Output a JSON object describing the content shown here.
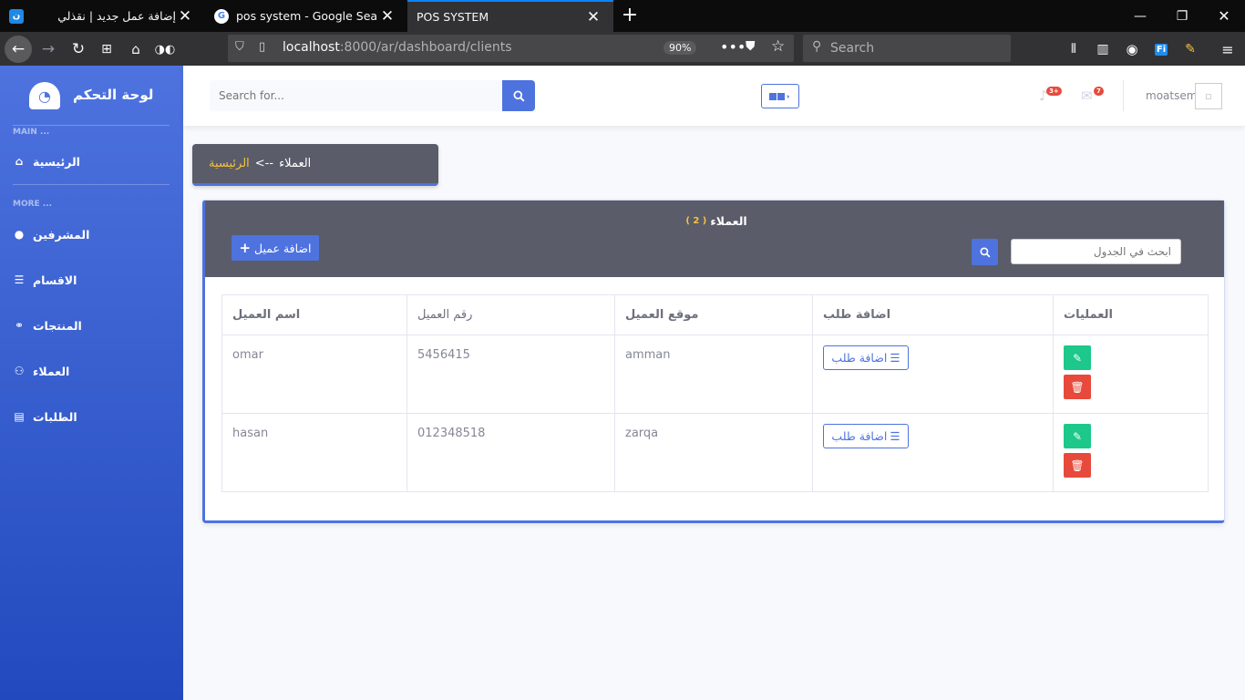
{
  "browser": {
    "tabs": [
      {
        "title": "إضافة عمل جديد | نقذلي",
        "favicon": "ن"
      },
      {
        "title": "pos system - Google Search",
        "favicon": "G"
      },
      {
        "title": "POS SYSTEM",
        "favicon": ""
      }
    ],
    "new_tab": "+",
    "url_host": "localhost",
    "url_rest": ":8000/ar/dashboard/clients",
    "zoom": "90%",
    "search_placeholder": "Search"
  },
  "sidebar": {
    "brand": "لوحة التحكم",
    "section_main": "MAIN ...",
    "section_more": "MORE ...",
    "items": [
      {
        "label": "الرئيسية",
        "icon": "home-icon"
      },
      {
        "label": "المشرفين",
        "icon": "user-circle-icon"
      },
      {
        "label": "الاقسام",
        "icon": "list-icon"
      },
      {
        "label": "المنتجات",
        "icon": "handshake-icon"
      },
      {
        "label": "العملاء",
        "icon": "users-icon"
      },
      {
        "label": "الطلبات",
        "icon": "table-icon"
      }
    ]
  },
  "topbar": {
    "search_placeholder": "Search for...",
    "alerts_badge": "3+",
    "messages_badge": "7",
    "username": "moatsem"
  },
  "breadcrumb": {
    "current": "العملاء",
    "separator": "<--",
    "home": "الرئيسية"
  },
  "card": {
    "title": "العملاء",
    "count": "( 2 )",
    "add_button": "اضافة عميل",
    "search_placeholder": "ابحث في الجدول"
  },
  "table": {
    "headers": [
      "اسم العميل",
      "رقم العميل",
      "موقع العميل",
      "اضافة طلب",
      "العمليات"
    ],
    "rows": [
      {
        "name": "omar",
        "number": "5456415",
        "location": "amman",
        "order": "اضافة طلب"
      },
      {
        "name": "hasan",
        "number": "012348518",
        "location": "zarqa",
        "order": "اضافة طلب"
      }
    ]
  },
  "colors": {
    "primary": "#4e73df",
    "success": "#1cc88a",
    "danger": "#e74a3b",
    "dark": "#5a5c69",
    "accent": "#f6c23e"
  }
}
